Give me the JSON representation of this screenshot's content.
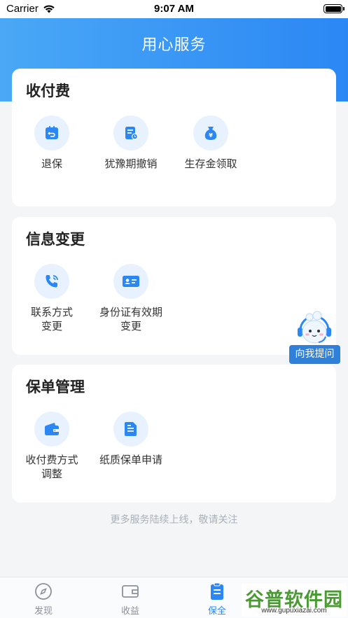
{
  "status_bar": {
    "carrier": "Carrier",
    "time": "9:07 AM"
  },
  "header": {
    "title": "用心服务"
  },
  "sections": [
    {
      "title": "收付费",
      "items": [
        {
          "label": "退保",
          "icon": "return-policy-icon"
        },
        {
          "label": "犹豫期撤销",
          "icon": "cooling-off-cancel-icon"
        },
        {
          "label": "生存金领取",
          "icon": "money-bag-icon"
        }
      ]
    },
    {
      "title": "信息变更",
      "items": [
        {
          "label": "联系方式\n变更",
          "icon": "phone-icon"
        },
        {
          "label": "身份证有效期\n变更",
          "icon": "id-card-icon"
        }
      ]
    },
    {
      "title": "保单管理",
      "items": [
        {
          "label": "收付费方式\n调整",
          "icon": "wallet-icon"
        },
        {
          "label": "纸质保单申请",
          "icon": "document-icon"
        }
      ]
    }
  ],
  "footer_note": "更多服务陆续上线，敬请关注",
  "assistant": {
    "label": "向我提问"
  },
  "tabbar": {
    "items": [
      {
        "label": "发现",
        "icon": "compass-icon",
        "active": false
      },
      {
        "label": "收益",
        "icon": "wallet-outline-icon",
        "active": false
      },
      {
        "label": "保全",
        "icon": "clipboard-icon",
        "active": true
      }
    ]
  },
  "watermark": {
    "main": "谷普软件园",
    "sub": "www.gupuxiazai.com"
  },
  "colors": {
    "primary": "#2b87f4",
    "icon_bg": "#e7f2fe",
    "page_bg": "#f4f5f7",
    "watermark_green": "#4a9a33"
  }
}
